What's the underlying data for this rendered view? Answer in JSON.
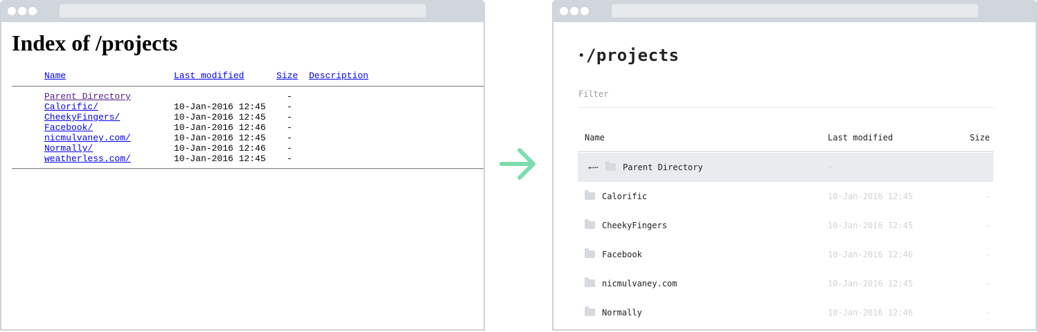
{
  "colors": {
    "chrome": "#d0d6dc",
    "arrow": "#7ddcb0",
    "link": "#0000ee",
    "visited_link": "#551a8b"
  },
  "before": {
    "title": "Index of /projects",
    "headers": {
      "name": "Name",
      "modified": "Last modified",
      "size": "Size",
      "description": "Description"
    },
    "parent": {
      "name": "Parent Directory",
      "size": "-"
    },
    "rows": [
      {
        "name": "Calorific/",
        "modified": "10-Jan-2016 12:45",
        "size": "-"
      },
      {
        "name": "CheekyFingers/",
        "modified": "10-Jan-2016 12:45",
        "size": "-"
      },
      {
        "name": "Facebook/",
        "modified": "10-Jan-2016 12:46",
        "size": "-"
      },
      {
        "name": "nicmulvaney.com/",
        "modified": "10-Jan-2016 12:45",
        "size": "-"
      },
      {
        "name": "Normally/",
        "modified": "10-Jan-2016 12:46",
        "size": "-"
      },
      {
        "name": "weatherless.com/",
        "modified": "10-Jan-2016 12:45",
        "size": "-"
      }
    ]
  },
  "after": {
    "bullet": "•",
    "title": "/projects",
    "filter_placeholder": "Filter",
    "headers": {
      "name": "Name",
      "modified": "Last modified",
      "size": "Size"
    },
    "parent": {
      "back_icon": "←⋯",
      "name": "Parent Directory",
      "modified": "-"
    },
    "rows": [
      {
        "name": "Calorific",
        "modified": "10-Jan-2016 12:45",
        "size": "-"
      },
      {
        "name": "CheekyFingers",
        "modified": "10-Jan-2016 12:45",
        "size": "-"
      },
      {
        "name": "Facebook",
        "modified": "10-Jan-2016 12:46",
        "size": "-"
      },
      {
        "name": "nicmulvaney.com",
        "modified": "10-Jan-2016 12:45",
        "size": "-"
      },
      {
        "name": "Normally",
        "modified": "10-Jan-2016 12:46",
        "size": "-"
      }
    ]
  }
}
